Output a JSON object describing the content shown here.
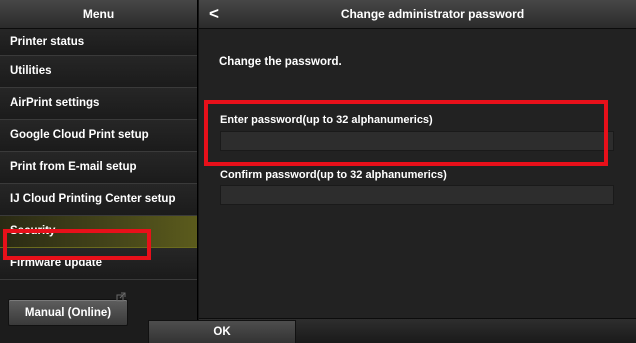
{
  "sidebar": {
    "header": "Menu",
    "items": [
      {
        "label": "Printer status"
      },
      {
        "label": "Utilities"
      },
      {
        "label": "AirPrint settings"
      },
      {
        "label": "Google Cloud Print setup"
      },
      {
        "label": "Print from E-mail setup"
      },
      {
        "label": "IJ Cloud Printing Center setup"
      },
      {
        "label": "Security",
        "selected": true
      },
      {
        "label": "Firmware update"
      }
    ],
    "manual_button": "Manual (Online)",
    "manual_icon": "external-link-icon"
  },
  "main": {
    "back_icon": "chevron-left-icon",
    "back_glyph": "<",
    "title": "Change administrator password",
    "instruction": "Change the password.",
    "password_field": {
      "label": "Enter password(up to 32 alphanumerics)",
      "value": ""
    },
    "confirm_field": {
      "label": "Confirm password(up to 32 alphanumerics)",
      "value": ""
    },
    "ok_button": "OK"
  },
  "colors": {
    "highlight": "#e8101a",
    "selected_item": "#5b5b1c",
    "background": "#222222"
  }
}
